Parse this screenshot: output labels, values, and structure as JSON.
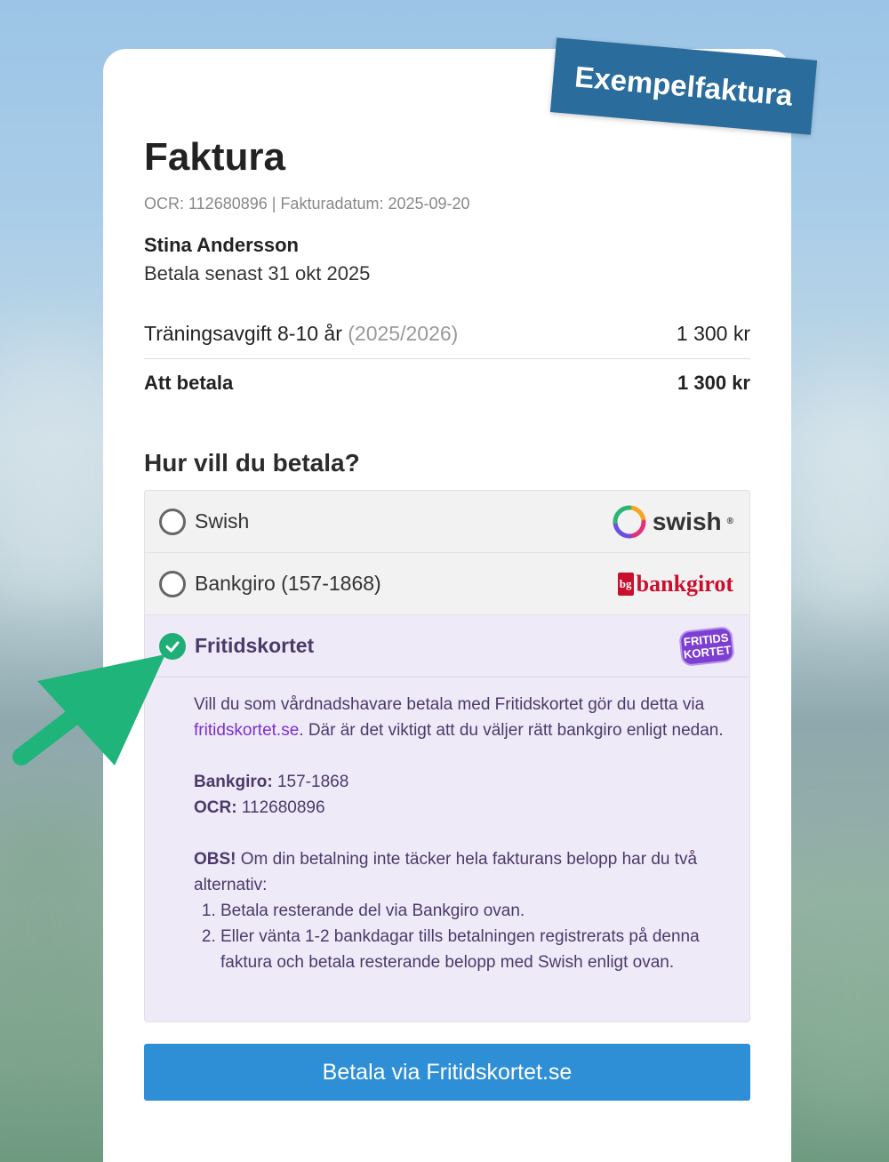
{
  "stamp": "Exempelfaktura",
  "invoice": {
    "title": "Faktura",
    "ocr_meta": "OCR: 112680896 | Fakturadatum: 2025-09-20",
    "customer": "Stina Andersson",
    "due": "Betala senast 31 okt 2025",
    "line_label": "Träningsavgift 8-10 år",
    "line_period": "(2025/2026)",
    "line_amount": "1 300 kr",
    "total_label": "Att betala",
    "total_amount": "1 300 kr"
  },
  "payment": {
    "heading": "Hur vill du betala?",
    "methods": [
      {
        "label": "Swish",
        "logo_text": "swish",
        "selected": false
      },
      {
        "label": "Bankgiro (157-1868)",
        "logo_text": "bankgirot",
        "selected": false
      },
      {
        "label": "Fritidskortet",
        "logo_text": "FRITIDS KORTET",
        "selected": true
      }
    ],
    "details": {
      "intro_pre": "Vill du som vårdnadshavare betala med Fritidskortet gör du detta via ",
      "intro_link": "fritidskortet.se",
      "intro_post": ". Där är det viktigt att du väljer rätt bankgiro enligt nedan.",
      "bankgiro_label": "Bankgiro:",
      "bankgiro_value": "157-1868",
      "ocr_label": "OCR:",
      "ocr_value": "112680896",
      "obs_label": "OBS!",
      "obs_text": "Om din betalning inte täcker hela fakturans belopp har du två alternativ:",
      "options": [
        "Betala resterande del via Bankgiro ovan.",
        "Eller vänta 1-2 bankdagar tills betalningen registrerats på denna faktura och betala resterande belopp med Swish enligt ovan."
      ]
    },
    "button": "Betala via Fritidskortet.se"
  },
  "colors": {
    "accent": "#2e8fd6",
    "stamp": "#2a6c9c",
    "selected_bg": "#efeaf8",
    "check": "#1fae76",
    "arrow": "#1fb47a",
    "link": "#7b2fd0"
  },
  "icons": [
    "swish-logo",
    "bankgirot-logo",
    "fritidskortet-logo",
    "check-circle-icon",
    "radio-icon",
    "pointer-arrow-icon"
  ]
}
